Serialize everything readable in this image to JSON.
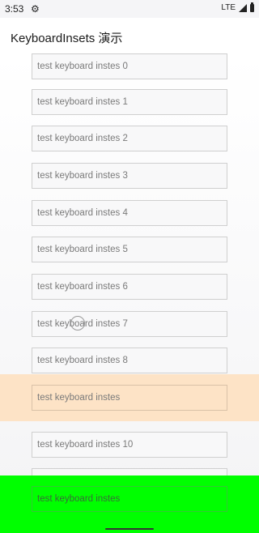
{
  "status_bar": {
    "time": "3:53",
    "network": "LTE"
  },
  "app_bar": {
    "title": "KeyboardInsets 演示"
  },
  "fields": [
    "test keyboard instes 0",
    "test keyboard instes 1",
    "test keyboard instes 2",
    "test keyboard instes 3",
    "test keyboard instes 4",
    "test keyboard instes 5",
    "test keyboard instes 6",
    "test keyboard instes 7",
    "test keyboard instes 8",
    "test keyboard instes 10"
  ],
  "highlight_field": "test keyboard instes",
  "bottom_field": "test keyboard instes",
  "colors": {
    "highlight": "#fde3c6",
    "bottom_bar": "#00ff00"
  }
}
